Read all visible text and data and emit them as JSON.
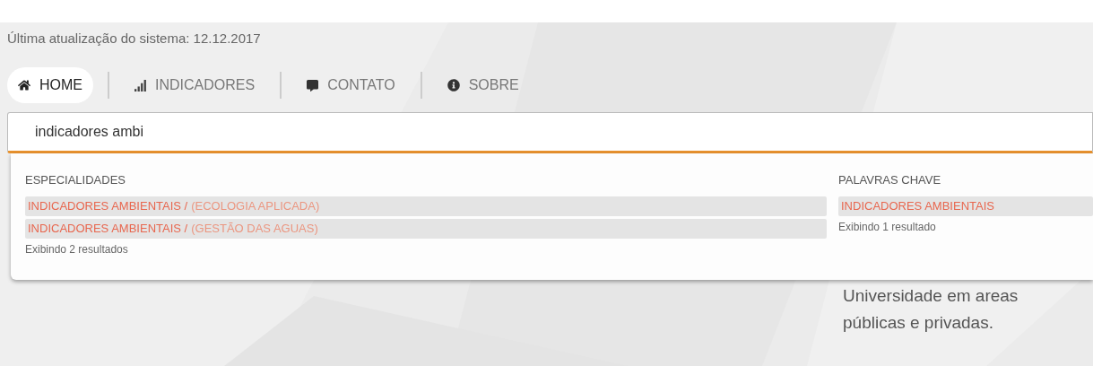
{
  "update_notice": "Última atualização do sistema: 12.12.2017",
  "nav": [
    {
      "label": "HOME",
      "kind": "home",
      "selected": true
    },
    {
      "label": "INDICADORES",
      "kind": "bars",
      "selected": false
    },
    {
      "label": "CONTATO",
      "kind": "chat",
      "selected": false
    },
    {
      "label": "SOBRE",
      "kind": "info",
      "selected": false
    }
  ],
  "search": {
    "value": "indicadores ambi"
  },
  "suggestions": [
    {
      "heading": "ESPECIALIDADES",
      "items": [
        {
          "main": "INDICADORES AMBIENTAIS /",
          "sub": "(ECOLOGIA APLICADA)"
        },
        {
          "main": "INDICADORES AMBIENTAIS /",
          "sub": "(GESTÃO DAS AGUAS)"
        }
      ],
      "count": "Exibindo 2 resultados"
    },
    {
      "heading": "PALAVRAS CHAVE",
      "items": [
        {
          "main": "INDICADORES AMBIENTAIS"
        }
      ],
      "count": "Exibindo 1 resultado"
    }
  ],
  "background_text": [
    "Universidade em areas",
    "públicas e privadas."
  ]
}
